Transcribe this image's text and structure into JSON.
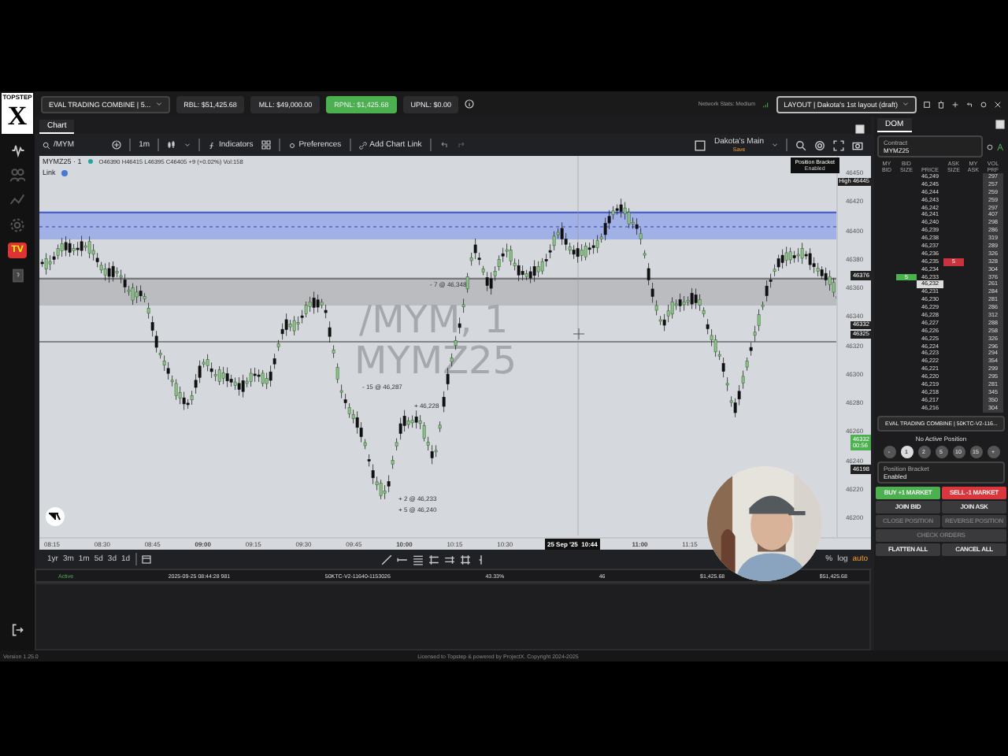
{
  "sidebar": {
    "logo_top": "TOPSTEP",
    "logo_mark": "X",
    "tv_badge": "TV"
  },
  "top_bar": {
    "account": "EVAL TRADING COMBINE | 5...",
    "stats": [
      {
        "label": "RBL: $51,425.68",
        "highlight": false
      },
      {
        "label": "MLL: $49,000.00",
        "highlight": false
      },
      {
        "label": "RPNL: $1,425.68",
        "highlight": true
      },
      {
        "label": "UPNL: $0.00",
        "highlight": false
      }
    ],
    "network": "Network Stats: Medium",
    "layout": "LAYOUT | Dakota's 1st layout (draft)"
  },
  "chart_tabs": [
    {
      "label": "Chart",
      "selected": true
    }
  ],
  "chart_toolbar": {
    "symbol": "/MYM",
    "interval": "1m",
    "indicators": "Indicators",
    "preferences": "Preferences",
    "chart_link": "Add Chart Link",
    "layout_name": "Dakota's Main",
    "layout_status": "Save"
  },
  "chart": {
    "legend_symbol": "MYMZ25 · 1",
    "legend_values": "O46390 H46415 L46395 C46405 +9 (+0.02%) Vol:158",
    "link": "Link",
    "tooltip_title": "Position Bracket",
    "tooltip_value": "Enabled",
    "watermark_1": "/MYM, 1",
    "watermark_2": "MYMZ25",
    "trade_labels": [
      "- 7 @ 46,348",
      "- 15 @ 46,287",
      "+ 46,228",
      "+ 2 @ 46,233",
      "+ 5 @ 46,240"
    ],
    "price_ticks": [
      "46450",
      "46420",
      "46400",
      "46380",
      "46360",
      "46340",
      "46320",
      "46300",
      "46280",
      "46260",
      "46240",
      "46220",
      "46200"
    ],
    "price_tags": [
      {
        "label": "High",
        "value": "46445",
        "kind": "dark"
      },
      {
        "value": "46376",
        "kind": "dark"
      },
      {
        "value": "46332",
        "kind": "dark"
      },
      {
        "value": "46325",
        "kind": "dark"
      },
      {
        "value": "46332",
        "label": "00:56",
        "kind": "green"
      },
      {
        "value": "46198",
        "kind": "dark"
      }
    ],
    "time_ticks": [
      {
        "label": "08:15",
        "bold": false
      },
      {
        "label": "08:30",
        "bold": false
      },
      {
        "label": "08:45",
        "bold": false
      },
      {
        "label": "09:00",
        "bold": true
      },
      {
        "label": "09:15",
        "bold": false
      },
      {
        "label": "09:30",
        "bold": false
      },
      {
        "label": "09:45",
        "bold": false
      },
      {
        "label": "10:00",
        "bold": true
      },
      {
        "label": "10:15",
        "bold": false
      },
      {
        "label": "10:30",
        "bold": false
      },
      {
        "label": "25 Sep '25  10:44",
        "bold": true,
        "cursor": true
      },
      {
        "label": "11:00",
        "bold": true
      },
      {
        "label": "11:15",
        "bold": false
      }
    ]
  },
  "range_buttons": [
    "1yr",
    "3m",
    "1m",
    "5d",
    "3d",
    "1d"
  ],
  "scale_options": [
    {
      "label": "%",
      "selected": false
    },
    {
      "label": "log",
      "selected": false
    },
    {
      "label": "auto",
      "selected": true
    }
  ],
  "positions_row": [
    "Active",
    "2025-09-25 08:44:28 981",
    "50KTC-V2-11640-1153026",
    "43.33%",
    "46",
    "$1,425.68",
    "$51,425.68"
  ],
  "footer": {
    "version": "Version 1.25.0",
    "license": "Licensed to Topstep & powered by ProjectX. Copyright 2024-2025"
  },
  "dom": {
    "tabs": [
      {
        "label": "DOM",
        "selected": true
      }
    ],
    "contract_label": "Contract",
    "contract": "MYMZ25",
    "columns": [
      "MY BID",
      "BID SIZE",
      "PRICE",
      "ASK SIZE",
      "MY ASK",
      "VOL PRF"
    ],
    "rows": [
      {
        "price": "46,249",
        "volume": "297",
        "last": false
      },
      {
        "price": "46,245",
        "volume": "257",
        "last": false
      },
      {
        "price": "46,244",
        "volume": "259",
        "last": false
      },
      {
        "price": "46,243",
        "volume": "259",
        "last": false
      },
      {
        "price": "46,242",
        "volume": "297",
        "last": false
      },
      {
        "price": "46,241",
        "volume": "407",
        "last": false
      },
      {
        "price": "46,240",
        "volume": "298",
        "last": false
      },
      {
        "price": "46,239",
        "volume": "286",
        "last": false
      },
      {
        "price": "46,238",
        "volume": "319",
        "last": false
      },
      {
        "price": "46,237",
        "volume": "289",
        "last": false
      },
      {
        "price": "46,236",
        "volume": "326",
        "last": false
      },
      {
        "price": "46,235",
        "volume": "328",
        "last": false,
        "ask": "5"
      },
      {
        "price": "46,234",
        "volume": "304",
        "last": false
      },
      {
        "price": "46,233",
        "volume": "376",
        "last": false,
        "bid": "5"
      },
      {
        "price": "46,232",
        "volume": "261",
        "last": true
      },
      {
        "price": "46,231",
        "volume": "284",
        "last": false
      },
      {
        "price": "46,230",
        "volume": "281",
        "last": false
      },
      {
        "price": "46,229",
        "volume": "286",
        "last": false
      },
      {
        "price": "46,228",
        "volume": "312",
        "last": false
      },
      {
        "price": "46,227",
        "volume": "288",
        "last": false
      },
      {
        "price": "46,226",
        "volume": "258",
        "last": false
      },
      {
        "price": "46,225",
        "volume": "326",
        "last": false
      },
      {
        "price": "46,224",
        "volume": "296",
        "last": false
      },
      {
        "price": "46,223",
        "volume": "294",
        "last": false
      },
      {
        "price": "46,222",
        "volume": "354",
        "last": false
      },
      {
        "price": "46,221",
        "volume": "299",
        "last": false
      },
      {
        "price": "46,220",
        "volume": "295",
        "last": false
      },
      {
        "price": "46,219",
        "volume": "281",
        "last": false
      },
      {
        "price": "46,218",
        "volume": "345",
        "last": false
      },
      {
        "price": "46,217",
        "volume": "350",
        "last": false
      },
      {
        "price": "46,216",
        "volume": "304",
        "last": false
      }
    ],
    "account": "EVAL TRADING COMBINE | 50KTC-V2-116...",
    "position": "No Active Position",
    "qty": [
      {
        "label": "-",
        "selected": false
      },
      {
        "label": "1",
        "selected": true
      },
      {
        "label": "2",
        "selected": false
      },
      {
        "label": "5",
        "selected": false
      },
      {
        "label": "10",
        "selected": false
      },
      {
        "label": "15",
        "selected": false
      },
      {
        "label": "+",
        "selected": false
      }
    ],
    "bracket_label": "Position Bracket",
    "bracket_value": "Enabled",
    "buttons": [
      {
        "label": "BUY +1 MARKET",
        "kind": "buy",
        "disabled": false
      },
      {
        "label": "SELL -1 MARKET",
        "kind": "sell",
        "disabled": false
      },
      {
        "label": "JOIN BID",
        "kind": "plain",
        "disabled": false
      },
      {
        "label": "JOIN ASK",
        "kind": "plain",
        "disabled": false
      },
      {
        "label": "CLOSE POSITION",
        "kind": "plain",
        "disabled": true
      },
      {
        "label": "REVERSE POSITION",
        "kind": "plain",
        "disabled": true
      },
      {
        "label": "CHECK ORDERS",
        "kind": "wide",
        "disabled": true
      },
      {
        "label": "FLATTEN ALL",
        "kind": "plain",
        "disabled": false
      },
      {
        "label": "CANCEL ALL",
        "kind": "plain",
        "disabled": false
      }
    ]
  },
  "webcam": {
    "kind": "picture"
  }
}
